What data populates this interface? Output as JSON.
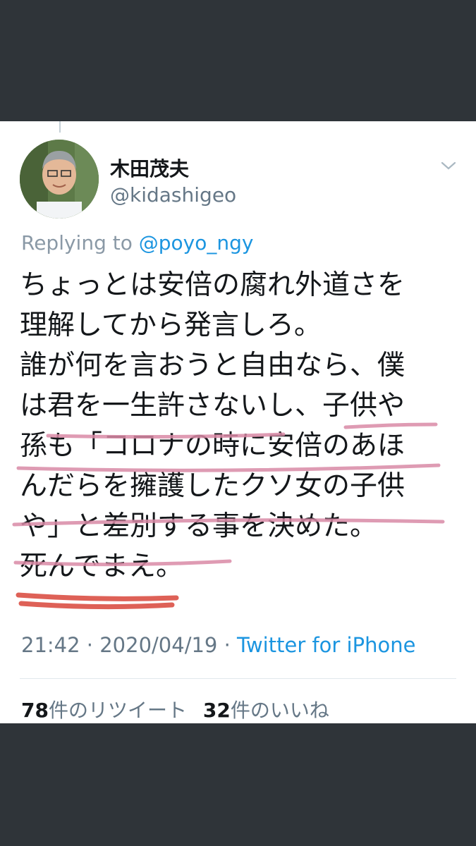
{
  "tweet": {
    "author_name": "木田茂夫",
    "author_handle": "@kidashigeo",
    "replying_prefix": "Replying to",
    "replying_to": "@poyo_ngy",
    "lines": [
      "ちょっとは安倍の腐れ外道さを",
      "理解してから発言しろ。",
      "誰が何を言おうと自由なら、僕",
      "は君を一生許さないし、子供や",
      "孫も「コロナの時に安倍のあほ",
      "んだらを擁護したクソ女の子供",
      "や」と差別する事を決めた。",
      "死んでまえ。"
    ],
    "time": "21:42",
    "date": "2020/04/19",
    "separator": "·",
    "source": "Twitter for iPhone",
    "retweet_count": "78",
    "retweet_label": "件のリツイート",
    "like_count": "32",
    "like_label": "件のいいね"
  },
  "colors": {
    "background": "#2f3439",
    "card": "#ffffff",
    "link": "#1b95e0",
    "muted": "#657786",
    "underline_pink": "#d98aa6",
    "underline_red": "#d9463a"
  },
  "icons": {
    "menu": "chevron-down-icon",
    "avatar": "avatar"
  }
}
